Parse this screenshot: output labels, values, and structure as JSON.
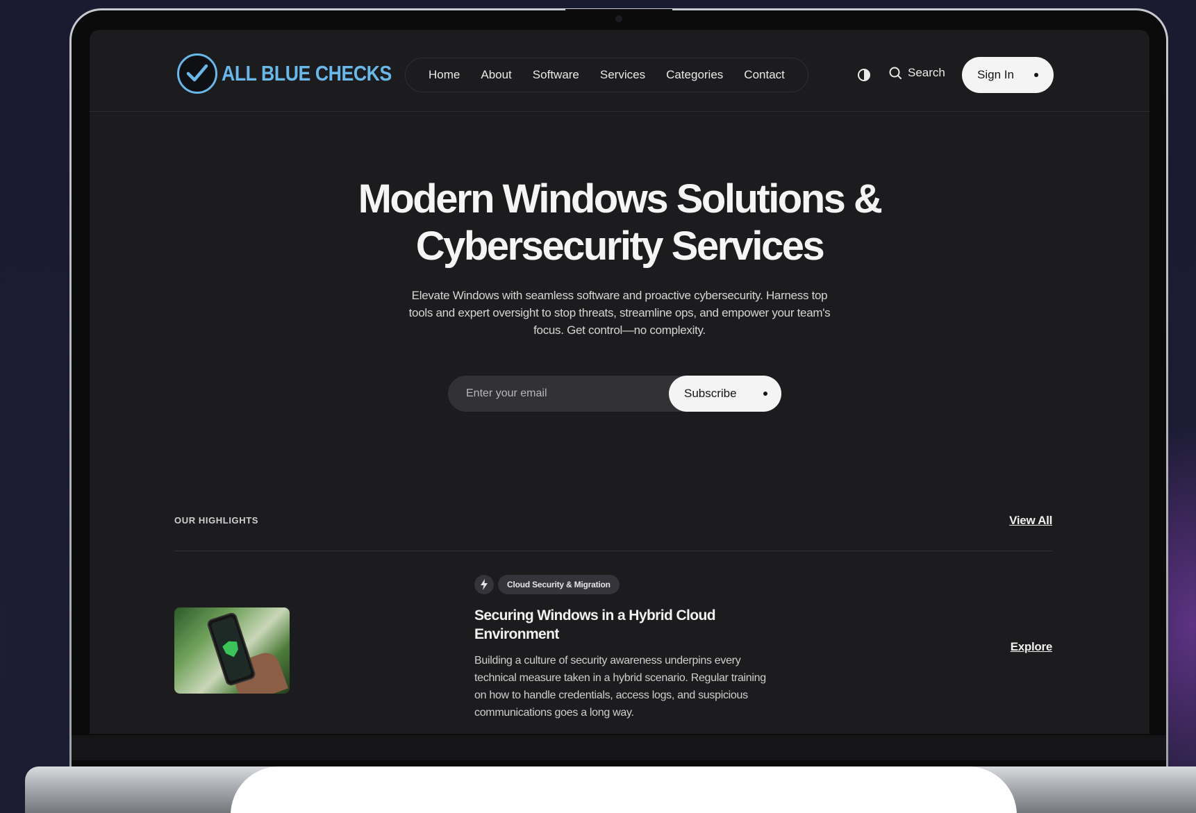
{
  "brand": {
    "name": "ALL BLUE CHECKS",
    "color": "#6ab7ea",
    "icon": "checkmark-icon"
  },
  "nav": {
    "items": [
      "Home",
      "About",
      "Software",
      "Services",
      "Categories",
      "Contact"
    ]
  },
  "header": {
    "theme_icon": "contrast-icon",
    "search_label": "Search",
    "search_icon": "search-icon",
    "signin_label": "Sign In"
  },
  "hero": {
    "title_line1": "Modern Windows Solutions &",
    "title_line2": "Cybersecurity Services",
    "description": "Elevate Windows with seamless software and proactive cybersecurity. Harness top tools and expert oversight to stop threats, streamline ops, and empower your team's focus. Get control—no complexity.",
    "email_placeholder": "Enter your email",
    "subscribe_label": "Subscribe"
  },
  "highlights": {
    "label": "OUR HIGHLIGHTS",
    "view_all": "View All",
    "articles": [
      {
        "category": "Cloud Security & Migration",
        "category_icon": "lightning-icon",
        "title": "Securing Windows in a Hybrid Cloud Environment",
        "description": "Building a culture of security awareness underpins every technical measure taken in a hybrid scenario. Regular training on how to handle credentials, access logs, and suspicious communications goes a long way.",
        "cta": "Explore"
      }
    ]
  },
  "colors": {
    "screen_bg": "#1c1c1e",
    "button_bg": "#f4f4f4",
    "text_primary": "#f5f5f5"
  }
}
